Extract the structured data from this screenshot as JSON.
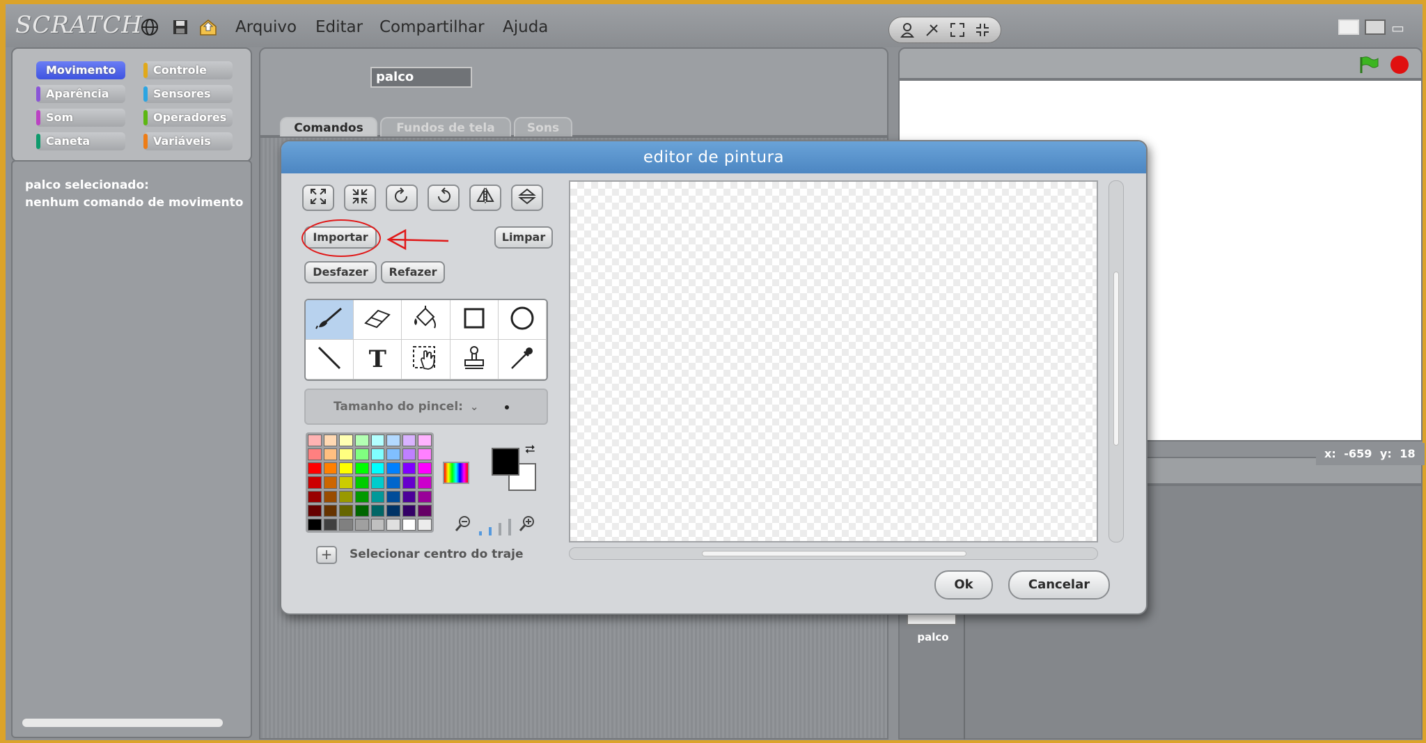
{
  "app": {
    "logo": "SCRATCH",
    "menu": [
      "Arquivo",
      "Editar",
      "Compartilhar",
      "Ajuda"
    ]
  },
  "categories": [
    {
      "label": "Movimento",
      "color": "#4a6cd4"
    },
    {
      "label": "Controle",
      "color": "#e1a91a"
    },
    {
      "label": "Aparência",
      "color": "#8a55d7"
    },
    {
      "label": "Sensores",
      "color": "#2ca5e2"
    },
    {
      "label": "Som",
      "color": "#bb42c3"
    },
    {
      "label": "Operadores",
      "color": "#5cb712"
    },
    {
      "label": "Caneta",
      "color": "#0e9a6c"
    },
    {
      "label": "Variáveis",
      "color": "#ee7d16"
    }
  ],
  "palette": {
    "line1": "palco selecionado:",
    "line2": "nenhum comando de movimento"
  },
  "sprite": {
    "name": "palco"
  },
  "tabs": [
    "Comandos",
    "Fundos de tela",
    "Sons"
  ],
  "stage": {
    "x_label": "x: -659",
    "y_label": "y: 18",
    "thumb_label": "palco"
  },
  "paint_editor": {
    "title": "editor de pintura",
    "import_label": "Importar",
    "clear_label": "Limpar",
    "undo_label": "Desfazer",
    "redo_label": "Refazer",
    "brush_size_label": "Tamanho do pincel:",
    "set_center_label": "Selecionar centro do traje",
    "ok_label": "Ok",
    "cancel_label": "Cancelar",
    "fg_color": "#000000",
    "bg_color": "#ffffff",
    "selected_tool": "paintbrush",
    "palette_colors": [
      [
        "#ffb3b3",
        "#ffd9b3",
        "#ffffb3",
        "#b3ffb3",
        "#b3ffff",
        "#b3d9ff",
        "#d9b3ff",
        "#ffb3ff"
      ],
      [
        "#ff8080",
        "#ffbf80",
        "#ffff80",
        "#80ff80",
        "#80ffff",
        "#80bfff",
        "#bf80ff",
        "#ff80ff"
      ],
      [
        "#ff0000",
        "#ff8000",
        "#ffff00",
        "#00ff00",
        "#00ffff",
        "#0080ff",
        "#8000ff",
        "#ff00ff"
      ],
      [
        "#cc0000",
        "#cc6600",
        "#cccc00",
        "#00cc00",
        "#00cccc",
        "#0066cc",
        "#6600cc",
        "#cc00cc"
      ],
      [
        "#990000",
        "#994c00",
        "#999900",
        "#009900",
        "#009999",
        "#004c99",
        "#4c0099",
        "#990099"
      ],
      [
        "#660000",
        "#663300",
        "#666600",
        "#006600",
        "#006666",
        "#003366",
        "#330066",
        "#660066"
      ],
      [
        "#000000",
        "#404040",
        "#808080",
        "#a0a0a0",
        "#c0c0c0",
        "#e0e0e0",
        "#ffffff",
        "#ececec"
      ]
    ]
  }
}
